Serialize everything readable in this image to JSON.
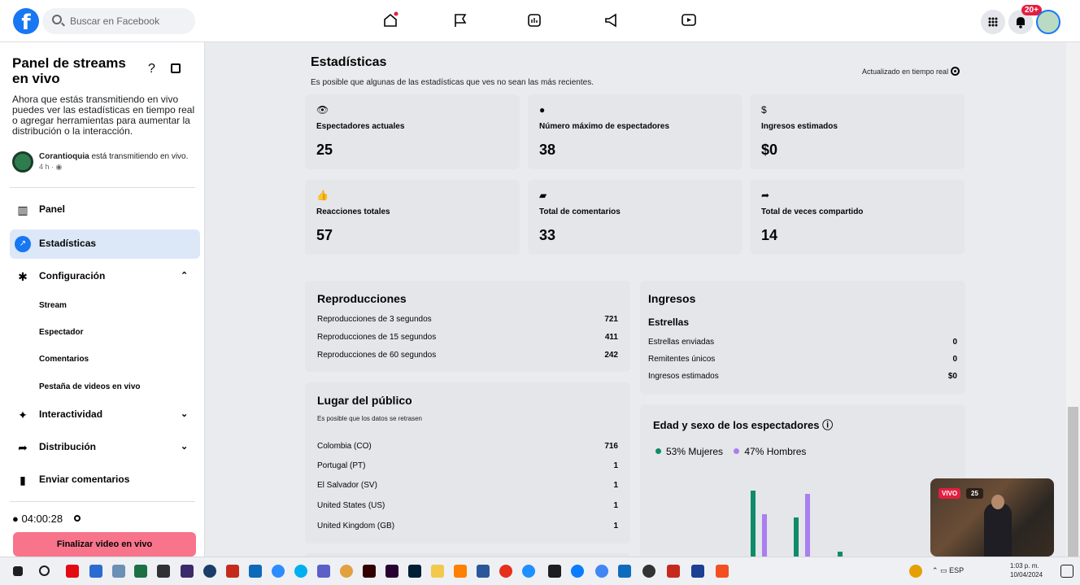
{
  "topbar": {
    "logo": "f",
    "search_placeholder": "Buscar en Facebook",
    "notification_badge": "20+"
  },
  "sidebar": {
    "title": "Panel de streams en vivo",
    "help": "?",
    "description": "Ahora que estás transmitiendo en vivo puedes ver las estadísticas en tiempo real o agregar herramientas para aumentar la distribución o la interacción.",
    "stream_owner": "Corantioquia",
    "stream_status": " está transmitiendo en vivo.",
    "stream_time": "4 h · ",
    "nav": {
      "panel": "Panel",
      "estadisticas": "Estadísticas",
      "configuracion": "Configuración",
      "stream": "Stream",
      "espectador": "Espectador",
      "comentarios": "Comentarios",
      "pestana": "Pestaña de videos en vivo",
      "interactividad": "Interactividad",
      "distribucion": "Distribución",
      "enviar": "Enviar comentarios"
    },
    "timer": "04:00:28",
    "end_button": "Finalizar video en vivo"
  },
  "main": {
    "title": "Estadísticas",
    "subtitle": "Es posible que algunas de las estadísticas que ves no sean las más recientes.",
    "realtime": "Actualizado en tiempo real",
    "stats": {
      "current_label": "Espectadores actuales",
      "current_value": "25",
      "max_label": "Número máximo de espectadores",
      "max_value": "38",
      "income_label": "Ingresos estimados",
      "income_value": "$0",
      "reactions_label": "Reacciones totales",
      "reactions_value": "57",
      "comments_label": "Total de comentarios",
      "comments_value": "33",
      "shares_label": "Total de veces compartido",
      "shares_value": "14"
    },
    "reproducciones": {
      "title": "Reproducciones",
      "r3_label": "Reproducciones de 3 segundos",
      "r3_value": "721",
      "r15_label": "Reproducciones de 15 segundos",
      "r15_value": "411",
      "r60_label": "Reproducciones de 60 segundos",
      "r60_value": "242"
    },
    "ingresos": {
      "title": "Ingresos",
      "subtitle": "Estrellas",
      "enviadas_label": "Estrellas enviadas",
      "enviadas_value": "0",
      "remitentes_label": "Remitentes únicos",
      "remitentes_value": "0",
      "estimados_label": "Ingresos estimados",
      "estimados_value": "$0"
    },
    "lugar": {
      "title": "Lugar del público",
      "note": "Es posible que los datos se retrasen",
      "c1_label": "Colombia (CO)",
      "c1_value": "716",
      "c2_label": "Portugal (PT)",
      "c2_value": "1",
      "c3_label": "El Salvador (SV)",
      "c3_value": "1",
      "c4_label": "United States (US)",
      "c4_value": "1",
      "c5_label": "United Kingdom (GB)",
      "c5_value": "1"
    },
    "edad": {
      "title": "Edad y sexo de los espectadores",
      "women": "53% Mujeres",
      "men": "47% Hombres"
    }
  },
  "video": {
    "live": "VIVO",
    "count": "25"
  },
  "taskbar": {
    "language": "ESP",
    "time": "1:03 p. m.",
    "date": "10/04/2024"
  },
  "colors": {
    "accent": "#1877f2",
    "women": "#0f8a6a",
    "men": "#a97ff0",
    "end_button": "#f7748b"
  }
}
